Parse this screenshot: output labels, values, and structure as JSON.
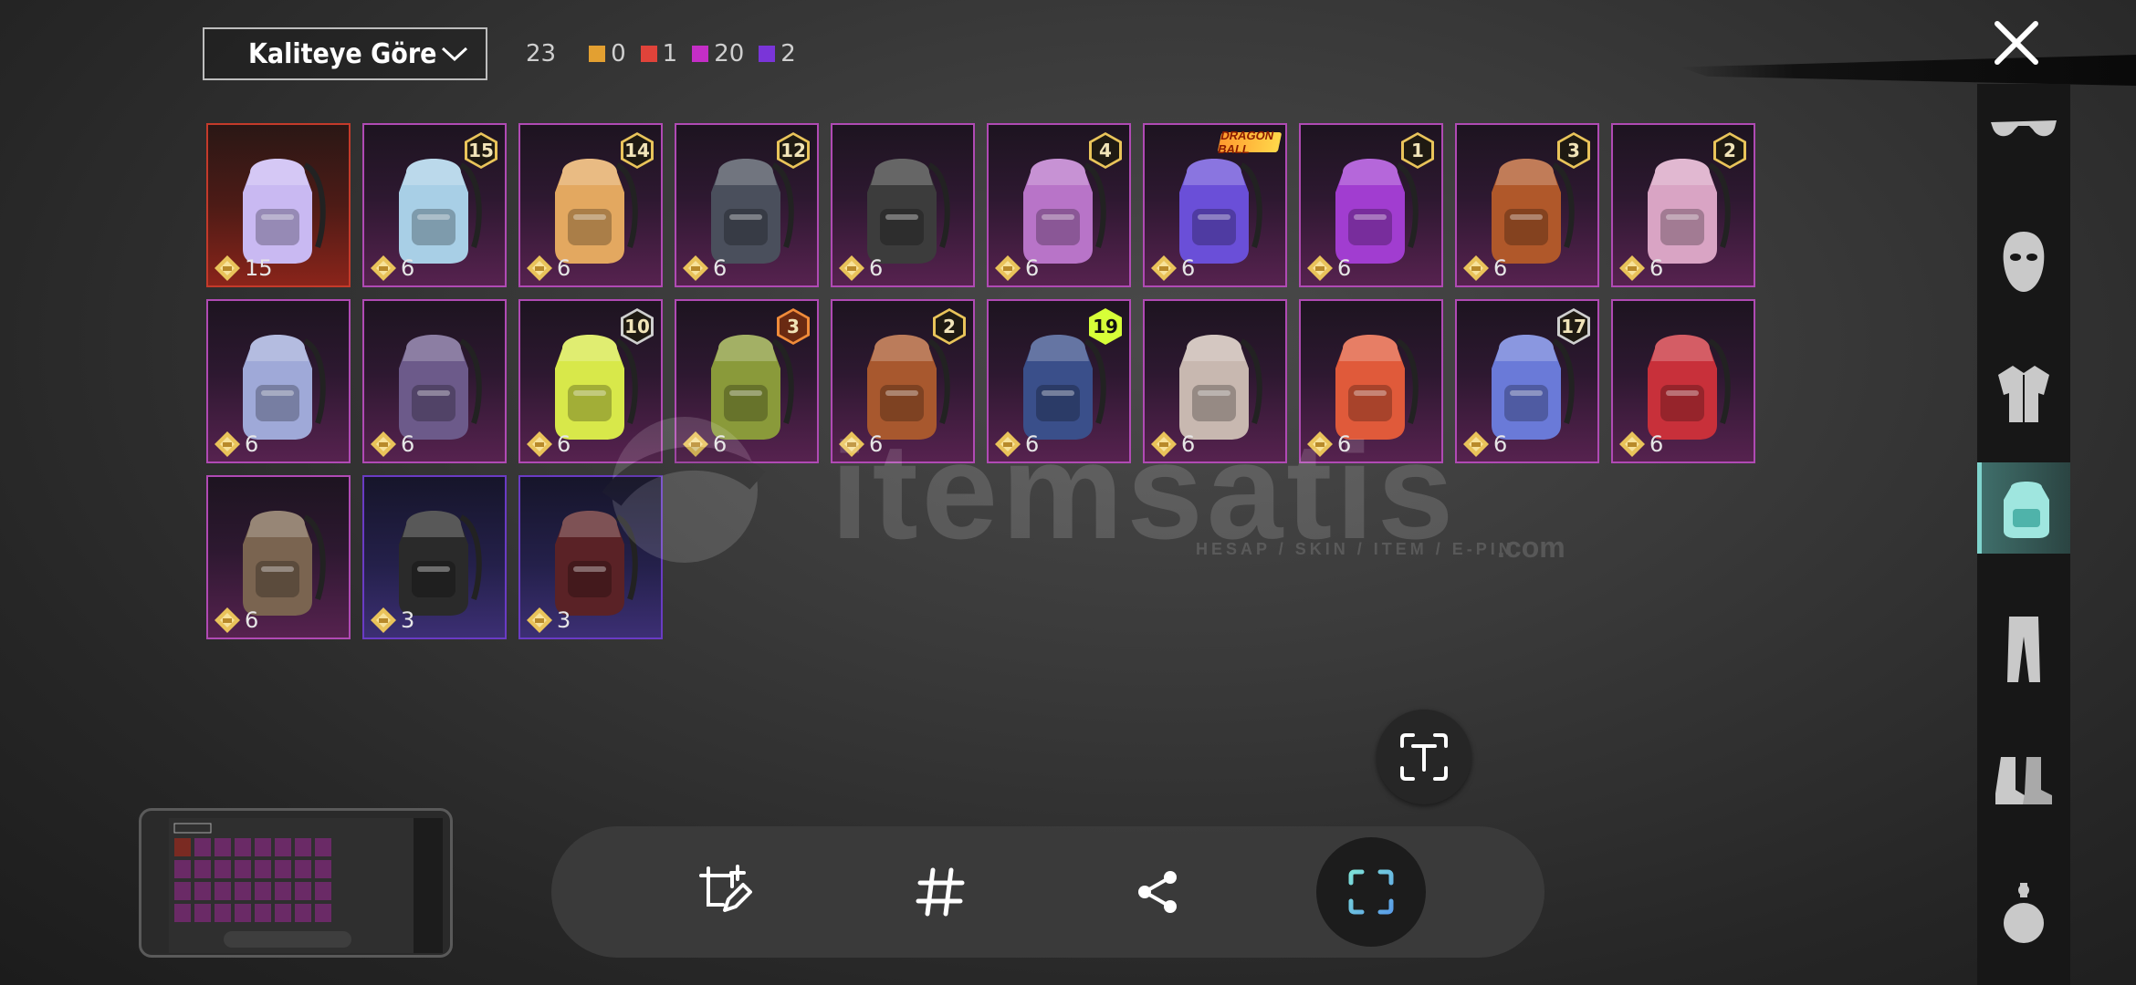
{
  "sort": {
    "label": "Kaliteye Göre"
  },
  "counts": {
    "total": "23",
    "qualities": [
      {
        "color": "#e3a031",
        "value": "0"
      },
      {
        "color": "#e0433a",
        "value": "1"
      },
      {
        "color": "#c42ec6",
        "value": "20"
      },
      {
        "color": "#7a35d8",
        "value": "2"
      }
    ]
  },
  "sidebar": {
    "items": [
      {
        "name": "glasses-icon",
        "active": false
      },
      {
        "name": "mask-icon",
        "active": false
      },
      {
        "name": "jacket-icon",
        "active": false
      },
      {
        "name": "backpack-icon",
        "active": true
      },
      {
        "name": "pants-icon",
        "active": false
      },
      {
        "name": "boots-icon",
        "active": false
      },
      {
        "name": "grenade-icon",
        "active": false
      }
    ]
  },
  "items": [
    {
      "quality": "red",
      "art": "butterfly",
      "color": "#c9b9f2",
      "level": "",
      "cost": "15"
    },
    {
      "quality": "pink",
      "art": "capsule",
      "color": "#a8cfe6",
      "level": "15",
      "cost": "6"
    },
    {
      "quality": "pink",
      "art": "corgi",
      "color": "#e3a860",
      "level": "14",
      "cost": "6"
    },
    {
      "quality": "pink",
      "art": "robot",
      "color": "#4a4f5c",
      "level": "12",
      "cost": "6"
    },
    {
      "quality": "pink",
      "art": "dark",
      "color": "#3c3c3c",
      "level": "",
      "cost": "6"
    },
    {
      "quality": "pink",
      "art": "cat",
      "color": "#b874c8",
      "level": "4",
      "cost": "6"
    },
    {
      "quality": "pink",
      "art": "shell",
      "color": "#6a4fd8",
      "badge": "DRAGON BALL",
      "level": "",
      "cost": "6"
    },
    {
      "quality": "pink",
      "art": "monster",
      "color": "#a13dd0",
      "level": "1",
      "cost": "6"
    },
    {
      "quality": "pink",
      "art": "crown",
      "color": "#b0582a",
      "level": "3",
      "cost": "6"
    },
    {
      "quality": "pink",
      "art": "spiky",
      "color": "#d9a4c4",
      "level": "2",
      "cost": "6"
    },
    {
      "quality": "pink",
      "art": "lotus",
      "color": "#9fa9d8",
      "level": "",
      "cost": "6"
    },
    {
      "quality": "pink",
      "art": "mecha",
      "color": "#6c5a8a",
      "level": "",
      "cost": "6"
    },
    {
      "quality": "pink",
      "art": "phone",
      "color": "#d8e84a",
      "level": "10",
      "cost": "6",
      "levelStyle": "dark"
    },
    {
      "quality": "pink",
      "art": "camo",
      "color": "#8a9a3a",
      "level": "3",
      "cost": "6",
      "levelStyle": "orange"
    },
    {
      "quality": "pink",
      "art": "tribal",
      "color": "#a8582e",
      "level": "2",
      "cost": "6"
    },
    {
      "quality": "pink",
      "art": "beetle",
      "color": "#3a4f8a",
      "level": "19",
      "cost": "6",
      "levelStyle": "yellow"
    },
    {
      "quality": "pink",
      "art": "samurai",
      "color": "#c8b8b0",
      "level": "",
      "cost": "6"
    },
    {
      "quality": "pink",
      "art": "racer",
      "color": "#e05a3a",
      "level": "",
      "cost": "6"
    },
    {
      "quality": "pink",
      "art": "demon",
      "color": "#6a7ad8",
      "level": "17",
      "cost": "6",
      "levelStyle": "dark"
    },
    {
      "quality": "pink",
      "art": "opera",
      "color": "#c8303a",
      "level": "",
      "cost": "6"
    },
    {
      "quality": "pink",
      "art": "military",
      "color": "#7a6450",
      "level": "",
      "cost": "6"
    },
    {
      "quality": "purple",
      "art": "tactical",
      "color": "#2a2a2a",
      "level": "",
      "cost": "3"
    },
    {
      "quality": "purple",
      "art": "redplaid",
      "color": "#5a2226",
      "level": "",
      "cost": "3"
    }
  ],
  "watermark": {
    "brand": "itemsatis",
    "tagline": "HESAP / SKIN / ITEM / E-PIN",
    "suffix": ".com"
  },
  "toolbar": {
    "buttons": [
      "crop-edit-icon",
      "hashtag-icon",
      "share-icon",
      "capture-icon"
    ]
  }
}
